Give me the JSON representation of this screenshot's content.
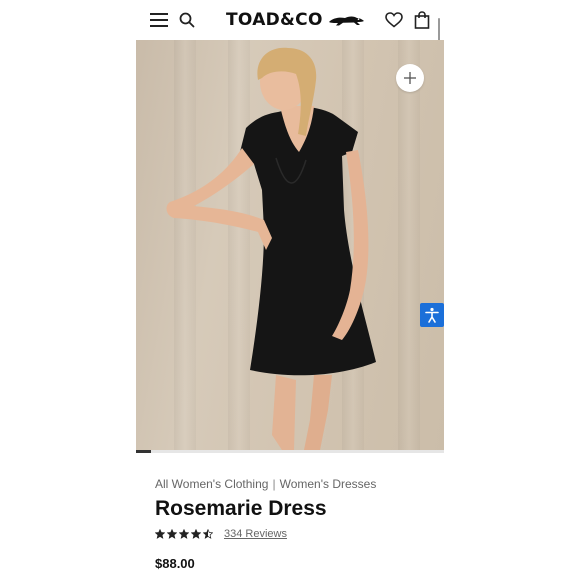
{
  "header": {
    "logo_text": "TOAD&CO"
  },
  "icons": {
    "menu": "hamburger-menu-icon",
    "search": "search-icon",
    "wishlist": "heart-icon",
    "bag": "shopping-bag-icon",
    "zoom": "plus-icon",
    "accessibility": "accessibility-icon"
  },
  "gallery": {
    "progress_fraction": 0.05
  },
  "breadcrumb": {
    "items": [
      "All Women's Clothing",
      "Women's Dresses"
    ],
    "separator": "|"
  },
  "product": {
    "title": "Rosemarie Dress",
    "rating": 4.5,
    "rating_max": 5,
    "reviews_label": "334 Reviews",
    "price": "$88.00"
  },
  "colors": {
    "accessibility_blue": "#1b6fd9",
    "text_primary": "#111111",
    "text_secondary": "#666666"
  }
}
